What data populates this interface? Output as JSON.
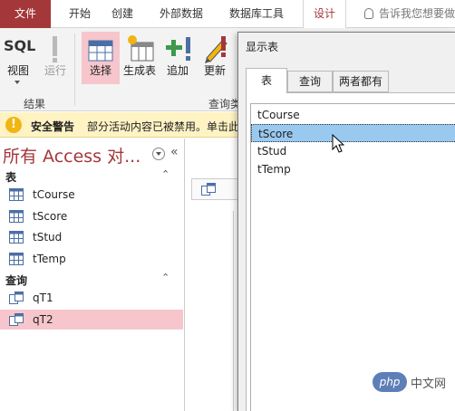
{
  "ribbon": {
    "tabs": [
      {
        "label": "文件"
      },
      {
        "label": "开始"
      },
      {
        "label": "创建"
      },
      {
        "label": "外部数据"
      },
      {
        "label": "数据库工具"
      },
      {
        "label": "设计"
      }
    ],
    "tell_me": "告诉我您想要做什么",
    "buttons": {
      "sql_top": "SQL",
      "view": "视图",
      "run": "运行",
      "select": "选择",
      "make_table": "生成表",
      "append": "追加",
      "update": "更新"
    },
    "groups": {
      "results": "结果",
      "query_type": "查询类"
    }
  },
  "security_bar": {
    "title": "安全警告",
    "message": "部分活动内容已被禁用。单击此处"
  },
  "nav": {
    "title": "所有 Access 对...",
    "collapse": "«",
    "sections": {
      "tables": {
        "label": "表",
        "chevron": "⌃"
      },
      "queries": {
        "label": "查询",
        "chevron": "⌃"
      }
    },
    "tables": [
      "tCourse",
      "tScore",
      "tStud",
      "tTemp"
    ],
    "queries": [
      "qT1",
      "qT2"
    ],
    "selected_query": "qT2"
  },
  "dialog": {
    "title": "显示表",
    "tabs": [
      "表",
      "查询",
      "两者都有"
    ],
    "active_tab": "表",
    "list": [
      "tCourse",
      "tScore",
      "tStud",
      "tTemp"
    ],
    "selected": "tScore"
  },
  "watermark": {
    "logo": "php",
    "text": "中文网"
  },
  "colors": {
    "accent": "#a4373a",
    "selection": "#f6c6cc",
    "list_selection": "#99c9ef",
    "warning_bg": "#fff3c4"
  }
}
